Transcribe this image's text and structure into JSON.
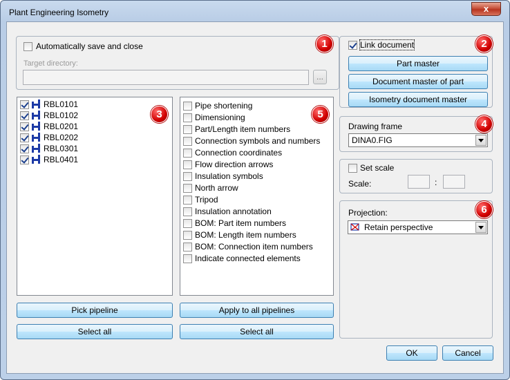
{
  "window": {
    "title": "Plant Engineering Isometry",
    "close_glyph": "x"
  },
  "section1": {
    "auto_save_label": "Automatically save and close",
    "auto_save_checked": false,
    "target_dir_label": "Target directory:",
    "target_dir_value": "",
    "browse_label": "...",
    "badge": "1"
  },
  "section2": {
    "link_document_label": "Link document",
    "link_document_checked": true,
    "buttons": [
      "Part master",
      "Document master of part",
      "Isometry document master"
    ],
    "badge": "2"
  },
  "pipelines": {
    "items": [
      {
        "label": "RBL0101",
        "checked": true
      },
      {
        "label": "RBL0102",
        "checked": true
      },
      {
        "label": "RBL0201",
        "checked": true
      },
      {
        "label": "RBL0202",
        "checked": true
      },
      {
        "label": "RBL0301",
        "checked": true
      },
      {
        "label": "RBL0401",
        "checked": true
      }
    ],
    "badge": "3",
    "pick_label": "Pick pipeline",
    "select_all_label": "Select all"
  },
  "options": {
    "items": [
      {
        "label": "Pipe shortening",
        "checked": false
      },
      {
        "label": "Dimensioning",
        "checked": false
      },
      {
        "label": "Part/Length item numbers",
        "checked": false
      },
      {
        "label": "Connection symbols and numbers",
        "checked": false
      },
      {
        "label": "Connection coordinates",
        "checked": false
      },
      {
        "label": "Flow direction arrows",
        "checked": false
      },
      {
        "label": "Insulation symbols",
        "checked": false
      },
      {
        "label": "North arrow",
        "checked": false
      },
      {
        "label": "Tripod",
        "checked": false
      },
      {
        "label": "Insulation annotation",
        "checked": false
      },
      {
        "label": "BOM: Part item numbers",
        "checked": false
      },
      {
        "label": "BOM: Length item numbers",
        "checked": false
      },
      {
        "label": "BOM: Connection item numbers",
        "checked": false
      },
      {
        "label": "Indicate connected elements",
        "checked": false
      }
    ],
    "badge": "5",
    "apply_label": "Apply to all pipelines",
    "select_all_label": "Select all"
  },
  "drawing_frame": {
    "label": "Drawing frame",
    "value": "DINA0.FIG",
    "badge": "4"
  },
  "scale": {
    "set_scale_label": "Set scale",
    "set_scale_checked": false,
    "scale_label": "Scale:",
    "separator": ":",
    "left_value": "",
    "right_value": ""
  },
  "projection": {
    "label": "Projection:",
    "value": "Retain perspective",
    "badge": "6"
  },
  "footer": {
    "ok_label": "OK",
    "cancel_label": "Cancel"
  },
  "colors": {
    "badge_red": "#d10000",
    "button_blue": "#bee6fd",
    "pipe_icon_blue": "#1c3aa6"
  }
}
